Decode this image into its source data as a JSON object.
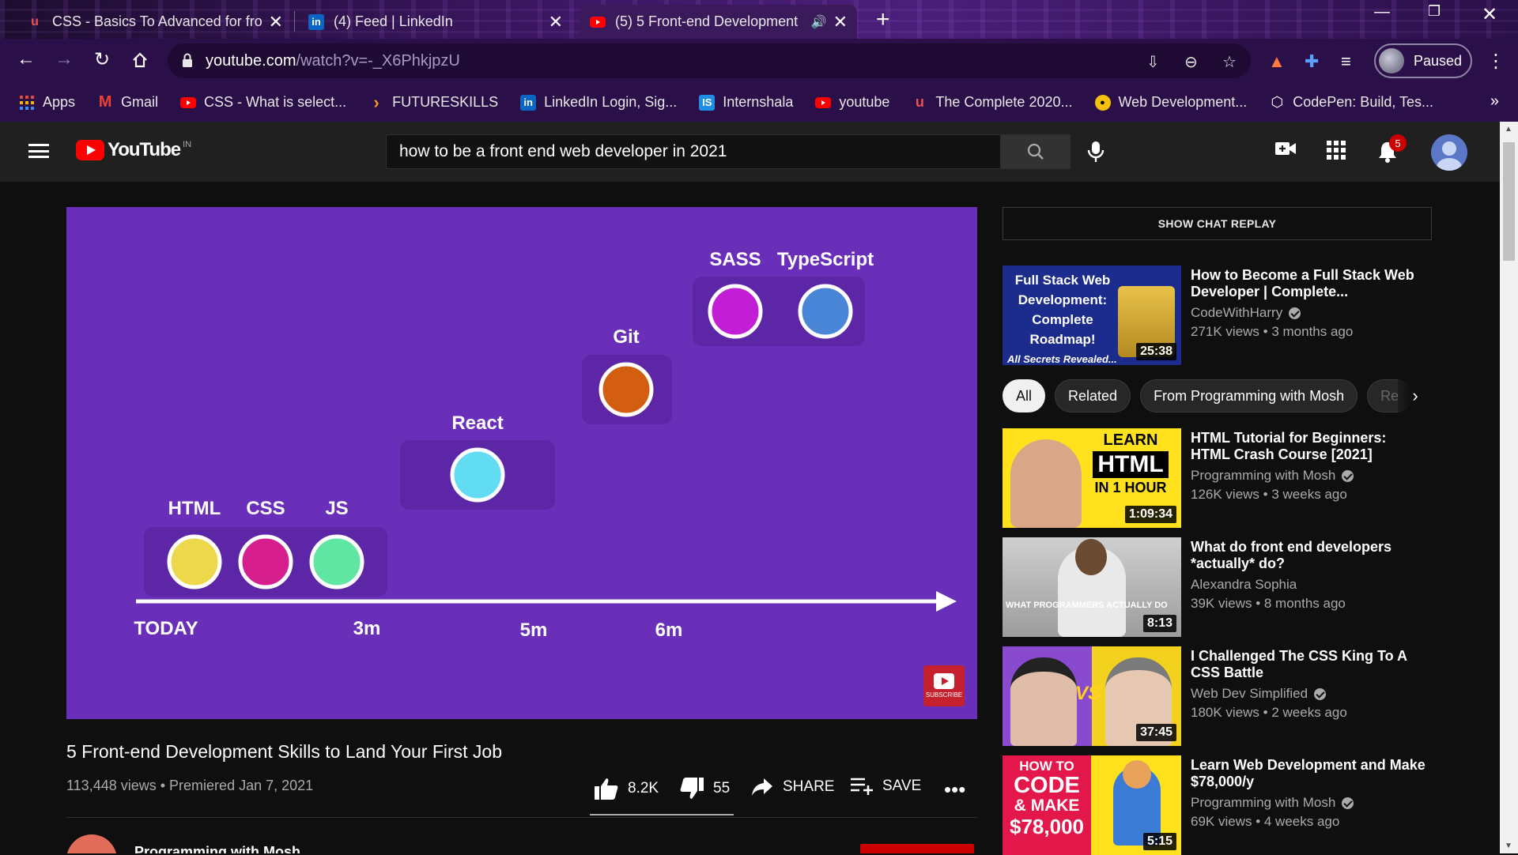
{
  "browser": {
    "tabs": [
      {
        "title": "CSS - Basics To Advanced for fron",
        "fav": "u",
        "active": false
      },
      {
        "title": "(4) Feed | LinkedIn",
        "fav": "in",
        "active": false
      },
      {
        "title": "(5) 5 Front-end Development",
        "fav": "yt",
        "active": true
      }
    ],
    "url_host": "youtube.com",
    "url_path": "/watch?v=-_X6PhkjpzU",
    "profile_label": "Paused",
    "bookmarks": [
      {
        "label": "Apps",
        "icon": "apps-grid-icon"
      },
      {
        "label": "Gmail",
        "icon": "gmail-icon"
      },
      {
        "label": "CSS - What is select...",
        "icon": "youtube-icon"
      },
      {
        "label": "FUTURESKILLS",
        "icon": "chevron-icon"
      },
      {
        "label": "LinkedIn Login, Sig...",
        "icon": "linkedin-icon"
      },
      {
        "label": "Internshala",
        "icon": "internshala-icon"
      },
      {
        "label": "youtube",
        "icon": "youtube-icon"
      },
      {
        "label": "The Complete 2020...",
        "icon": "udemy-icon"
      },
      {
        "label": "Web Development...",
        "icon": "webdev-icon"
      },
      {
        "label": "CodePen: Build, Tes...",
        "icon": "codepen-icon"
      }
    ]
  },
  "youtube": {
    "logo_text": "YouTube",
    "region": "IN",
    "search_query": "how to be a front end web developer  in 2021",
    "notification_count": "5"
  },
  "player": {
    "skills": {
      "html": "HTML",
      "css": "CSS",
      "js": "JS",
      "react": "React",
      "git": "Git",
      "sass": "SASS",
      "typescript": "TypeScript"
    },
    "axis": {
      "today": "TODAY",
      "m3": "3m",
      "m5": "5m",
      "m6": "6m"
    },
    "subscribe_text": "SUBSCRIBE",
    "colors": {
      "background": "#6a2fb8",
      "box": "#5d26a6",
      "html": "#ecd84a",
      "css": "#d61f8c",
      "js": "#5ee6a2",
      "react": "#61dcf2",
      "git": "#d35e11",
      "sass": "#c21ed6",
      "typescript": "#4a86d8"
    }
  },
  "video": {
    "title": "5 Front-end Development Skills to Land Your First Job",
    "meta": "113,448 views • Premiered Jan 7, 2021",
    "likes": "8.2K",
    "dislikes": "55",
    "share": "SHARE",
    "save": "SAVE",
    "channel": "Programming with Mosh"
  },
  "sidebar": {
    "chat_replay": "SHOW CHAT REPLAY",
    "first_rec": {
      "title": "How to Become a Full Stack Web Developer | Complete...",
      "channel": "CodeWithHarry",
      "meta": "271K views • 3 months ago",
      "duration": "25:38",
      "thumb_text": "Full Stack Web Development: Complete Roadmap!",
      "thumb_bottom": "All Secrets Revealed..."
    },
    "chips": [
      "All",
      "Related",
      "From Programming with Mosh",
      "Re"
    ],
    "recs": [
      {
        "title": "HTML Tutorial for Beginners: HTML Crash Course [2021]",
        "channel": "Programming with Mosh",
        "meta": "126K views • 3 weeks ago",
        "duration": "1:09:34",
        "t1": "LEARN",
        "t2": "HTML",
        "t3": "IN 1 HOUR"
      },
      {
        "title": "What do front end developers *actually* do?",
        "channel": "Alexandra Sophia",
        "meta": "39K views • 8 months ago",
        "duration": "8:13",
        "cap": "WHAT PROGRAMMERS ACTUALLY DO"
      },
      {
        "title": "I Challenged The CSS King To A CSS Battle",
        "channel": "Web Dev Simplified",
        "meta": "180K views • 2 weeks ago",
        "duration": "37:45",
        "vs": "VS"
      },
      {
        "title": "Learn Web Development and Make $78,000/y",
        "channel": "Programming with Mosh",
        "meta": "69K views • 4 weeks ago",
        "duration": "5:15",
        "a": "HOW TO",
        "b": "CODE",
        "c": "& MAKE",
        "d": "$78,000"
      }
    ]
  }
}
